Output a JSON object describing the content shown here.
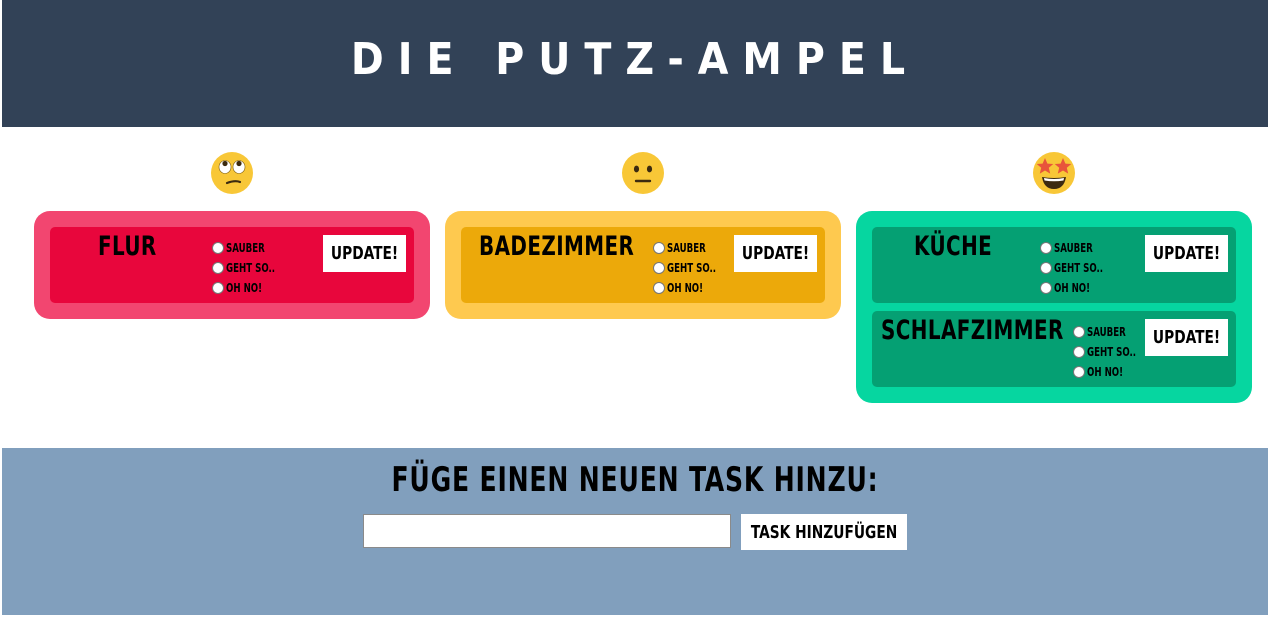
{
  "header": {
    "title": "DIE PUTZ-AMPEL"
  },
  "columns": [
    {
      "face": "face-with-rolling-eyes-icon",
      "color": "red",
      "tasks": [
        {
          "name": "FLUR",
          "options": [
            "SAUBER",
            "GEHT SO..",
            "OH NO!"
          ],
          "button": "UPDATE!"
        }
      ]
    },
    {
      "face": "neutral-face-icon",
      "color": "yellow",
      "tasks": [
        {
          "name": "BADEZIMMER",
          "options": [
            "SAUBER",
            "GEHT SO..",
            "OH NO!"
          ],
          "button": "UPDATE!"
        }
      ]
    },
    {
      "face": "star-struck-face-icon",
      "color": "green",
      "tasks": [
        {
          "name": "KÜCHE",
          "options": [
            "SAUBER",
            "GEHT SO..",
            "OH NO!"
          ],
          "button": "UPDATE!"
        },
        {
          "name": "SCHLAFZIMMER",
          "options": [
            "SAUBER",
            "GEHT SO..",
            "OH NO!"
          ],
          "button": "UPDATE!"
        }
      ]
    }
  ],
  "footer": {
    "heading": "FÜGE EINEN NEUEN TASK HINZU:",
    "input_value": "",
    "button": "TASK HINZUFÜGEN"
  },
  "colors": {
    "header_bg": "#324257",
    "footer_bg": "#819fbd",
    "red": "#e8063c",
    "yellow": "#eca90a",
    "green": "#05a073"
  }
}
